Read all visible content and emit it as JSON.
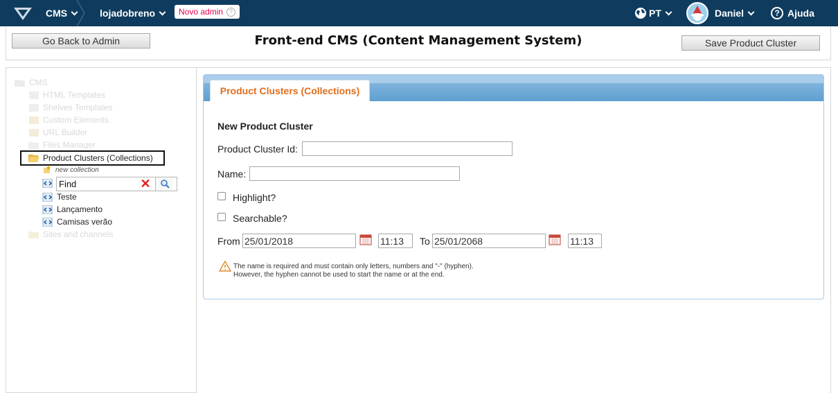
{
  "topbar": {
    "cms_label": "CMS",
    "store_label": "lojadobreno",
    "badge_label": "Novo admin",
    "lang_label": "PT",
    "user_label": "Daniel",
    "help_label": "Ajuda"
  },
  "header": {
    "back_label": "Go Back to Admin",
    "title": "Front-end CMS (Content Management System)",
    "save_label": "Save Product Cluster"
  },
  "tree": {
    "root": "CMS",
    "items": [
      {
        "label": "HTML Templates"
      },
      {
        "label": "Shelves Templates"
      },
      {
        "label": "Custom Elements"
      },
      {
        "label": "URL Builder"
      },
      {
        "label": "Files Manager"
      },
      {
        "label": "Product Clusters (Collections)"
      },
      {
        "label": "Sites and channels"
      }
    ],
    "new_collection": "new collection",
    "find_value": "Find",
    "children": [
      {
        "label": "Teste"
      },
      {
        "label": "Lançamento"
      },
      {
        "label": "Camisas verão"
      }
    ]
  },
  "card": {
    "tab_label": "Product Clusters (Collections)",
    "form_title": "New Product Cluster",
    "id_label": "Product Cluster Id:",
    "id_value": "",
    "name_label": "Name:",
    "name_value": "",
    "highlight_label": "Highlight?",
    "highlight_checked": false,
    "searchable_label": "Searchable?",
    "searchable_checked": false,
    "from_label": "From",
    "from_date": "25/01/2018",
    "from_time": "11:13",
    "to_label": "To",
    "to_date": "25/01/2068",
    "to_time": "11:13",
    "note_line1": "The name is required and must contain only letters, numbers and \"-\" (hyphen).",
    "note_line2": "However, the hyphen cannot be used to start the name or at the end."
  },
  "colors": {
    "topbar": "#0f3c5e",
    "accent_orange": "#e36d1c",
    "badge_text": "#e5004c",
    "card_border": "#a9c9e3"
  }
}
